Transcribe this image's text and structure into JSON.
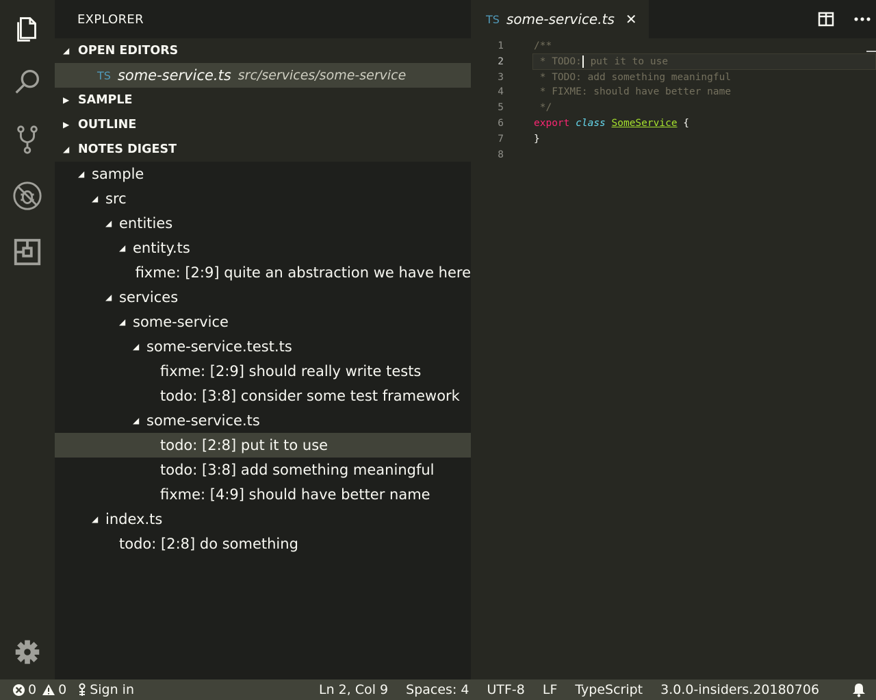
{
  "sidebar": {
    "title": "EXPLORER",
    "open_editors": {
      "header": "OPEN EDITORS",
      "badge": "TS",
      "file": "some-service.ts",
      "path": "src/services/some-service"
    },
    "sample_header": "SAMPLE",
    "outline_header": "OUTLINE",
    "notes_header": "NOTES DIGEST",
    "tree": [
      {
        "label": "sample",
        "depth": 0,
        "twisty": true
      },
      {
        "label": "src",
        "depth": 1,
        "twisty": true
      },
      {
        "label": "entities",
        "depth": 2,
        "twisty": true
      },
      {
        "label": "entity.ts",
        "depth": 3,
        "twisty": true
      },
      {
        "label": "fixme: [2:9] quite an abstraction we have here",
        "depth": 4,
        "twisty": false
      },
      {
        "label": "services",
        "depth": 2,
        "twisty": true
      },
      {
        "label": "some-service",
        "depth": 3,
        "twisty": true
      },
      {
        "label": "some-service.test.ts",
        "depth": 4,
        "twisty": true
      },
      {
        "label": "fixme: [2:9] should really write tests",
        "depth": 5,
        "twisty": false
      },
      {
        "label": "todo: [3:8] consider some test framework",
        "depth": 5,
        "twisty": false
      },
      {
        "label": "some-service.ts",
        "depth": 4,
        "twisty": true
      },
      {
        "label": "todo: [2:8] put it to use",
        "depth": 5,
        "twisty": false,
        "selected": true
      },
      {
        "label": "todo: [3:8] add something meaningful",
        "depth": 5,
        "twisty": false
      },
      {
        "label": "fixme: [4:9] should have better name",
        "depth": 5,
        "twisty": false
      },
      {
        "label": "index.ts",
        "depth": 1,
        "twisty": true
      },
      {
        "label": "todo: [2:8] do something",
        "depth": 2,
        "twisty": false
      }
    ]
  },
  "editor": {
    "tab_badge": "TS",
    "tab_name": "some-service.ts",
    "close_glyph": "✕",
    "line_numbers": [
      "1",
      "2",
      "3",
      "4",
      "5",
      "6",
      "7",
      "8"
    ],
    "lines": {
      "l1": "/**",
      "l2a": " * TODO:",
      "l2b": " put it to use",
      "l3": " * TODO: add something meaningful",
      "l4": " * FIXME: should have better name",
      "l5": " */",
      "l6_kw": "export",
      "l6_st": "class",
      "l6_cn": "SomeService",
      "l6_br": "{",
      "l7": "}"
    }
  },
  "status": {
    "errors": "0",
    "warnings": "0",
    "sign_in": "Sign in",
    "position": "Ln 2, Col 9",
    "spaces": "Spaces: 4",
    "encoding": "UTF-8",
    "eol": "LF",
    "language": "TypeScript",
    "version": "3.0.0-insiders.20180706"
  },
  "colors": {
    "accent_ts": "#519aba",
    "keyword": "#f92672",
    "storage": "#66d9ef",
    "class_name": "#a6e22e",
    "comment": "#75715e"
  }
}
